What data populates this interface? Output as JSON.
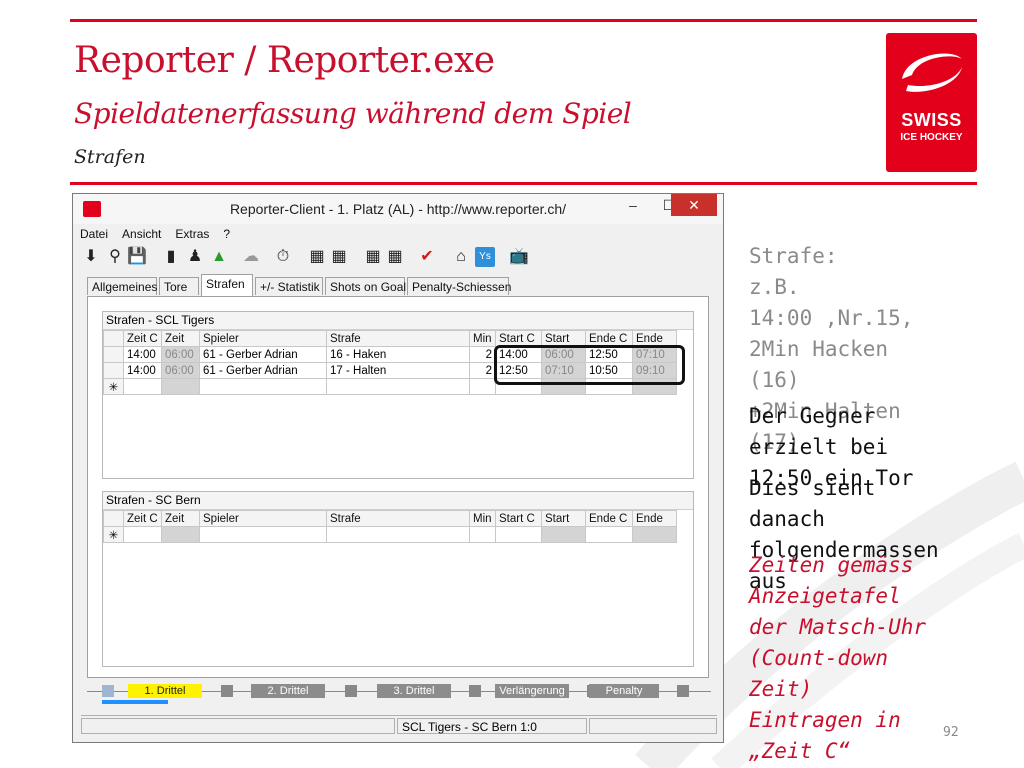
{
  "slide": {
    "title": "Reporter / Reporter.exe",
    "subtitle": "Spieldatenerfassung während dem Spiel",
    "section": "Strafen",
    "logo_line1": "SWISS",
    "logo_line2": "ICE HOCKEY",
    "page_number": "92",
    "accent_color": "#e2001a"
  },
  "window": {
    "title": "Reporter-Client  -  1. Platz (AL)  -  http://www.reporter.ch/",
    "minimize": "–",
    "maximize": "☐",
    "close": "✕",
    "menu": [
      "Datei",
      "Ansicht",
      "Extras",
      "?"
    ],
    "toolbar_icons": [
      "download-icon",
      "search-icon",
      "save-icon",
      "clipboard-icon",
      "players-icon",
      "upload-icon",
      "cloud-icon",
      "stopwatch-icon",
      "team-a-icon",
      "team-b-icon",
      "lineup-a-icon",
      "lineup-b-icon",
      "checkmark-icon",
      "home-icon",
      "ys-icon",
      "tv-icon"
    ],
    "tabs": [
      "Allgemeines",
      "Tore",
      "Strafen",
      "+/- Statistik",
      "Shots on Goal",
      "Penalty-Schiessen"
    ],
    "active_tab": "Strafen",
    "columns": [
      "Zeit C",
      "Zeit",
      "Spieler",
      "Strafe",
      "Min",
      "Start C",
      "Start",
      "Ende C",
      "Ende"
    ],
    "home": {
      "title": "Strafen - SCL Tigers",
      "rows": [
        [
          "14:00",
          "06:00",
          "61 - Gerber Adrian",
          "16 - Haken",
          "2",
          "14:00",
          "06:00",
          "12:50",
          "07:10"
        ],
        [
          "14:00",
          "06:00",
          "61 - Gerber Adrian",
          "17 - Halten",
          "2",
          "12:50",
          "07:10",
          "10:50",
          "09:10"
        ]
      ],
      "new_row_marker": "✳"
    },
    "away": {
      "title": "Strafen - SC Bern",
      "rows": [],
      "new_row_marker": "✳"
    },
    "periods": [
      "1. Drittel",
      "2. Drittel",
      "3. Drittel",
      "Verlängerung",
      "Penalty"
    ],
    "active_period": "1. Drittel",
    "status": "SCL Tigers - SC Bern 1:0"
  },
  "notes": {
    "gray": "Strafe:\nz.B.\n14:00 ,Nr.15,\n2Min Hacken\n(16)\n+2Min Halten\n(17)",
    "black1": "Der Gegner\nerzielt bei\n12:50 ein Tor",
    "black2": "Dies sieht\ndanach\nfolgendermassen\naus",
    "red": "Zeiten gemäss\nAnzeigetafel\nder Matsch-Uhr\n(Count-down\nZeit)\nEintragen in\n„Zeit C“"
  }
}
